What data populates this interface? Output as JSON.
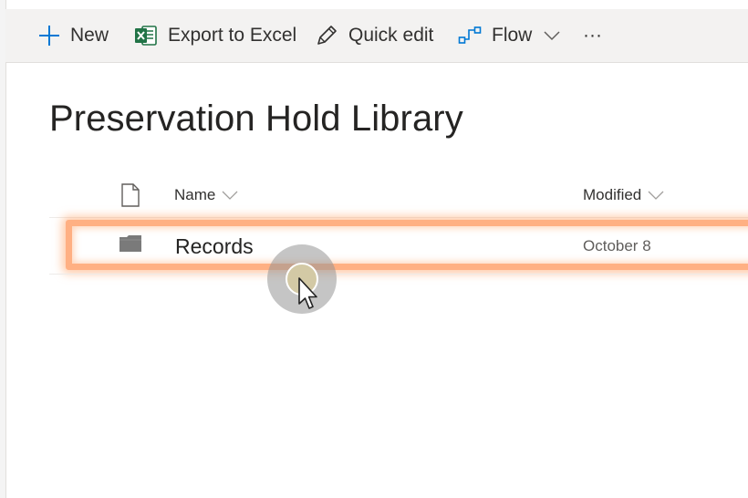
{
  "toolbar": {
    "new_label": "New",
    "export_label": "Export to Excel",
    "quick_edit_label": "Quick edit",
    "flow_label": "Flow",
    "more_label": "···"
  },
  "library": {
    "title": "Preservation Hold Library"
  },
  "columns": {
    "name": "Name",
    "modified": "Modified"
  },
  "rows": [
    {
      "name": "Records",
      "modified": "October 8",
      "type": "folder",
      "highlighted": true
    }
  ],
  "icons": {
    "new": "plus-icon",
    "export": "excel-icon",
    "quick_edit": "pencil-icon",
    "flow": "flow-icon",
    "flow_menu": "chevron-down-icon",
    "file_type": "document-icon",
    "row_type": "folder-icon",
    "cursor": "mouse-cursor-icon"
  },
  "colors": {
    "accent": "#0078d4",
    "excel_green": "#217346",
    "highlight_orange": "#ff965a",
    "command_bar_bg": "#f3f2f1"
  }
}
